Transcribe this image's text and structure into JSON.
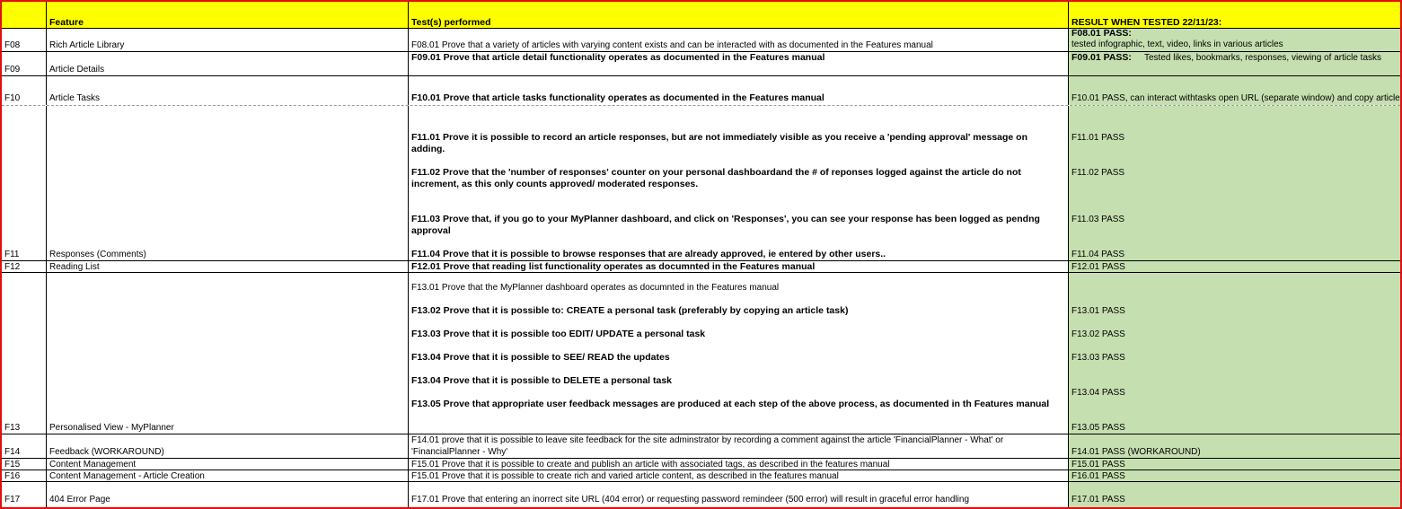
{
  "header": {
    "id": "",
    "feature": "Feature",
    "tests": "Test(s) performed",
    "result": "RESULT WHEN TESTED 22/11/23:"
  },
  "rows": [
    {
      "id": "F08",
      "feature": "Rich Article Library",
      "tests": [
        "F08.01 Prove that a variety of articles with varying content exists and can be interacted with as documented in the Features manual"
      ],
      "results": [
        "F08.01 PASS:",
        "tested infographic, text, video, links in various articles"
      ]
    },
    {
      "id": "F09",
      "feature": "Article Details",
      "tests": [
        "F09.01 Prove that article detail functionality operates as documented in the Features manual"
      ],
      "results": [
        "F09.01 PASS:",
        "Tested likes, bookmarks, responses, viewing of article tasks"
      ]
    },
    {
      "id": "F10",
      "feature": "Article Tasks",
      "tests": [
        "F10.01 Prove that article tasks functionality operates as documented in the Features manual"
      ],
      "results": [
        "F10.01 PASS, can interact withtasks open URL (separate window) and copy article"
      ]
    },
    {
      "id": "F11",
      "feature": "Responses (Comments)",
      "tests": [
        "F11.01 Prove it is possible to record an article responses, but are not immediately visible as you receive a 'pending approval' message on adding.",
        "F11.02 Prove that the 'number of responses' counter on your personal dashboardand the # of reponses logged against the article do not increment, as this only counts approved/ moderated responses.",
        "F11.03 Prove that, if you go to your MyPlanner dashboard, and click on 'Responses', you can see your response has been logged as pendng approval",
        "F11.04  Prove that it is possible to browse responses that are already approved, ie entered by other users.."
      ],
      "results": [
        "F11.01 PASS",
        "F11.02 PASS",
        "F11.03 PASS",
        "F11.04 PASS"
      ]
    },
    {
      "id": "F12",
      "feature": "Reading List",
      "tests": [
        "F12.01 Prove that reading list functionality operates as documnted in the Features manual"
      ],
      "results": [
        "F12.01 PASS"
      ]
    },
    {
      "id": "F13",
      "feature": "Personalised View - MyPlanner",
      "tests": [
        "F13.01 Prove that the MyPlanner dashboard operates as documnted in the Features manual",
        "F13.02 Prove that it is possible to:  CREATE a personal task (preferably by copying an article task)",
        "F13.03 Prove that it is possible too EDIT/ UPDATE a personal task",
        "F13.04 Prove that it is possible to SEE/ READ the updates",
        "F13.04 Prove that it is possible to DELETE a personal task",
        "F13.05 Prove that appropriate user feedback messages are produced at each step of the above process, as documented in th Features manual"
      ],
      "results": [
        "F13.01 PASS",
        "F13.02 PASS",
        "F13.03 PASS",
        "F13.04 PASS",
        "F13.05 PASS"
      ]
    },
    {
      "id": "F14",
      "feature": "Feedback (WORKAROUND)",
      "tests": [
        "F14.01 prove that it is possible to leave site feedback for the site adminstrator by recording a comment against the article 'FinancialPlanner - What' or 'FinancialPlanner - Why'"
      ],
      "results": [
        "F14.01 PASS (WORKAROUND)"
      ]
    },
    {
      "id": "F15",
      "feature": "Content Management",
      "tests": [
        "F15.01 Prove that it is possible to create and publish an article with associated tags, as described in the features manual"
      ],
      "results": [
        "F15.01 PASS"
      ]
    },
    {
      "id": "F16",
      "feature": "Content Management - Article Creation",
      "tests": [
        "F15.01 Prove that it is possible to create rich and varied article content, as described in the features manual"
      ],
      "results": [
        "F16.01 PASS"
      ]
    },
    {
      "id": "F17",
      "feature": "404 Error Page",
      "tests": [
        "F17.01 Prove that entering an inorrect site URL (404 error) or requesting password remindeer (500 error) will result in graceful error handling"
      ],
      "results": [
        "F17.01 PASS"
      ]
    }
  ],
  "colors": {
    "header": "#ffff00",
    "result": "#c6dfb0",
    "frame": "#e01010"
  }
}
